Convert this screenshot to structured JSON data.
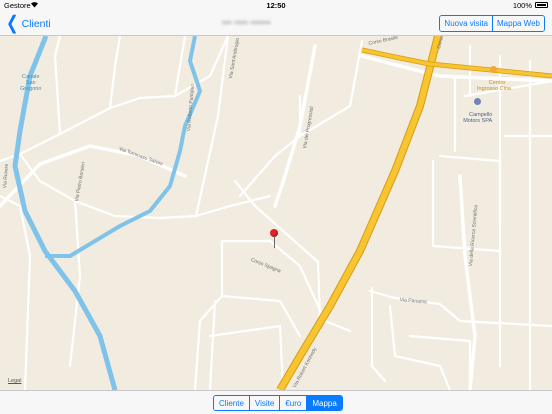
{
  "status_bar": {
    "carrier": "Gestore",
    "wifi_icon": "wifi-icon",
    "time": "12:50",
    "battery_percent": "100%",
    "battery_icon": "battery-icon"
  },
  "nav": {
    "back_label": "Clienti",
    "back_icon": "chevron-left-icon",
    "title": "▪▪▪ ▪▪▪▪ ▪▪▪▪▪▪",
    "buttons": [
      "Nuova visita",
      "Mappa Web"
    ]
  },
  "map": {
    "streets": [
      "Corso Brasile",
      "Corso Brasile",
      "Via Sant'Ambrogio",
      "Via Roberto Pantaleo",
      "Via dei Progressisti",
      "Via Tommaso Salvini",
      "Via Pietro Borsieri",
      "Via Ruvere",
      "Corso Spagna",
      "Via della Ricerca Scientifica",
      "Via Panama",
      "Via Robert Kennedy"
    ],
    "places": {
      "canale": "Canale\nSan\nGregorio",
      "centro": "Centro\nIngrosso Cina",
      "campello": "Campello\nMotors SPA"
    },
    "pin_icon": "map-pin-icon",
    "legal": "Legal",
    "colors": {
      "land": "#f1ecdf",
      "river": "#7fc3ea",
      "highway": "#f7c530",
      "road": "#ffffff",
      "pin": "#e42127"
    }
  },
  "tabs": {
    "items": [
      "Cliente",
      "Visite",
      "€uro",
      "Mappa"
    ],
    "active": "Mappa"
  }
}
